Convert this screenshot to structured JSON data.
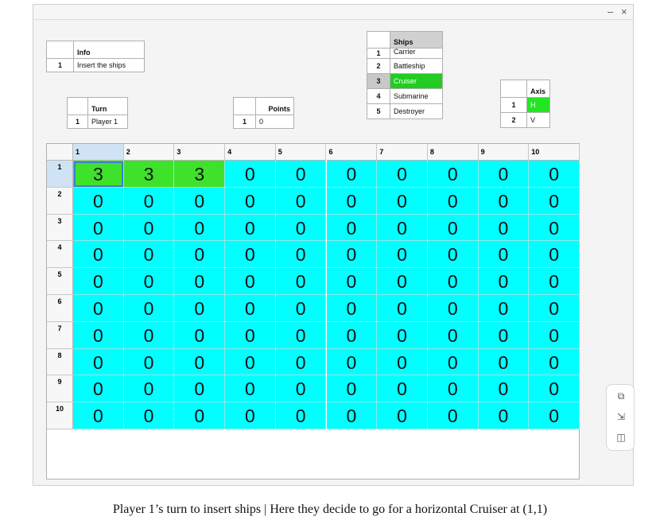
{
  "window": {
    "minimize": "–",
    "close": "×"
  },
  "info": {
    "header": "Info",
    "rows": [
      {
        "index": "1",
        "value": "Insert the ships"
      }
    ]
  },
  "turn": {
    "header": "Turn",
    "rows": [
      {
        "index": "1",
        "value": "Player 1"
      }
    ]
  },
  "points": {
    "header": "Points",
    "rows": [
      {
        "index": "1",
        "value": "0"
      }
    ]
  },
  "ships": {
    "header": "Ships",
    "selected_color": "#22cc22",
    "rows": [
      {
        "index": "1",
        "value": "Carrier"
      },
      {
        "index": "2",
        "value": "Battleship"
      },
      {
        "index": "3",
        "value": "Cruiser",
        "selected": true
      },
      {
        "index": "4",
        "value": "Submarine"
      },
      {
        "index": "5",
        "value": "Destroyer"
      }
    ]
  },
  "axis": {
    "header": "Axis",
    "rows": [
      {
        "index": "1",
        "value": "H",
        "selected": true
      },
      {
        "index": "2",
        "value": "V"
      }
    ]
  },
  "board": {
    "col_headers": [
      "1",
      "2",
      "3",
      "4",
      "5",
      "6",
      "7",
      "8",
      "9",
      "10"
    ],
    "row_headers": [
      "1",
      "2",
      "3",
      "4",
      "5",
      "6",
      "7",
      "8",
      "9",
      "10"
    ],
    "cells": [
      [
        "3",
        "3",
        "3",
        "0",
        "0",
        "0",
        "0",
        "0",
        "0",
        "0"
      ],
      [
        "0",
        "0",
        "0",
        "0",
        "0",
        "0",
        "0",
        "0",
        "0",
        "0"
      ],
      [
        "0",
        "0",
        "0",
        "0",
        "0",
        "0",
        "0",
        "0",
        "0",
        "0"
      ],
      [
        "0",
        "0",
        "0",
        "0",
        "0",
        "0",
        "0",
        "0",
        "0",
        "0"
      ],
      [
        "0",
        "0",
        "0",
        "0",
        "0",
        "0",
        "0",
        "0",
        "0",
        "0"
      ],
      [
        "0",
        "0",
        "0",
        "0",
        "0",
        "0",
        "0",
        "0",
        "0",
        "0"
      ],
      [
        "0",
        "0",
        "0",
        "0",
        "0",
        "0",
        "0",
        "0",
        "0",
        "0"
      ],
      [
        "0",
        "0",
        "0",
        "0",
        "0",
        "0",
        "0",
        "0",
        "0",
        "0"
      ],
      [
        "0",
        "0",
        "0",
        "0",
        "0",
        "0",
        "0",
        "0",
        "0",
        "0"
      ],
      [
        "0",
        "0",
        "0",
        "0",
        "0",
        "0",
        "0",
        "0",
        "0",
        "0"
      ]
    ],
    "ship_color": "#3ee22a",
    "water_color": "#00ffff",
    "selected_cell": [
      0,
      0
    ]
  },
  "side_panel": {
    "icons": [
      "window-restore-icon",
      "picture-in-picture-icon",
      "sidebar-panel-icon"
    ]
  },
  "caption": "Player 1’s turn to insert ships | Here they decide to go for a horizontal Cruiser at (1,1)"
}
